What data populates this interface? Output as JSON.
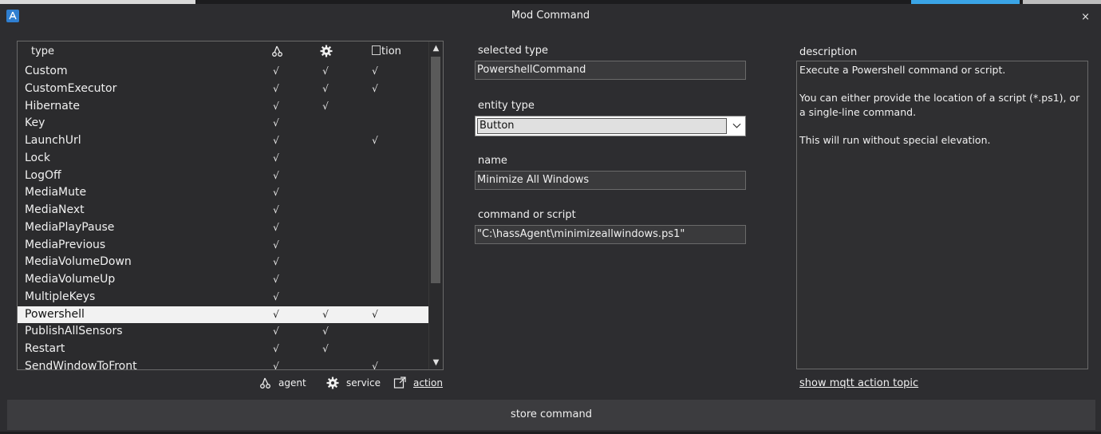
{
  "window": {
    "title": "Mod Command",
    "close_label": "×"
  },
  "list": {
    "header": {
      "type_label": "type",
      "agent_icon": "hass-agent-icon",
      "service_icon": "gear-icon",
      "action_label": "tion"
    },
    "rows": [
      {
        "name": "Custom",
        "agent": "√",
        "service": "√",
        "action": "√"
      },
      {
        "name": "CustomExecutor",
        "agent": "√",
        "service": "√",
        "action": "√"
      },
      {
        "name": "Hibernate",
        "agent": "√",
        "service": "√",
        "action": ""
      },
      {
        "name": "Key",
        "agent": "√",
        "service": "",
        "action": ""
      },
      {
        "name": "LaunchUrl",
        "agent": "√",
        "service": "",
        "action": "√"
      },
      {
        "name": "Lock",
        "agent": "√",
        "service": "",
        "action": ""
      },
      {
        "name": "LogOff",
        "agent": "√",
        "service": "",
        "action": ""
      },
      {
        "name": "MediaMute",
        "agent": "√",
        "service": "",
        "action": ""
      },
      {
        "name": "MediaNext",
        "agent": "√",
        "service": "",
        "action": ""
      },
      {
        "name": "MediaPlayPause",
        "agent": "√",
        "service": "",
        "action": ""
      },
      {
        "name": "MediaPrevious",
        "agent": "√",
        "service": "",
        "action": ""
      },
      {
        "name": "MediaVolumeDown",
        "agent": "√",
        "service": "",
        "action": ""
      },
      {
        "name": "MediaVolumeUp",
        "agent": "√",
        "service": "",
        "action": ""
      },
      {
        "name": "MultipleKeys",
        "agent": "√",
        "service": "",
        "action": ""
      },
      {
        "name": "Powershell",
        "agent": "√",
        "service": "√",
        "action": "√",
        "selected": true
      },
      {
        "name": "PublishAllSensors",
        "agent": "√",
        "service": "√",
        "action": ""
      },
      {
        "name": "Restart",
        "agent": "√",
        "service": "√",
        "action": ""
      },
      {
        "name": "SendWindowToFront",
        "agent": "√",
        "service": "",
        "action": "√"
      }
    ]
  },
  "legend": {
    "agent": "agent",
    "service": "service",
    "action": "action"
  },
  "form": {
    "selected_type_label": "selected type",
    "selected_type_value": "PowershellCommand",
    "entity_type_label": "entity type",
    "entity_type_value": "Button",
    "name_label": "name",
    "name_value": "Minimize All Windows",
    "command_label": "command or script",
    "command_value": "\"C:\\hassAgent\\minimizeallwindows.ps1\""
  },
  "description": {
    "label": "description",
    "text": "Execute a Powershell command or script.\n\nYou can either provide the location of a script (*.ps1), or a single-line command.\n\nThis will run without special elevation."
  },
  "mqtt_link": "show mqtt action topic",
  "store_button": "store command",
  "colors": {
    "background": "#2d2d30",
    "selected_row": "#f2f2f2",
    "accent": "#2f7fd1"
  }
}
